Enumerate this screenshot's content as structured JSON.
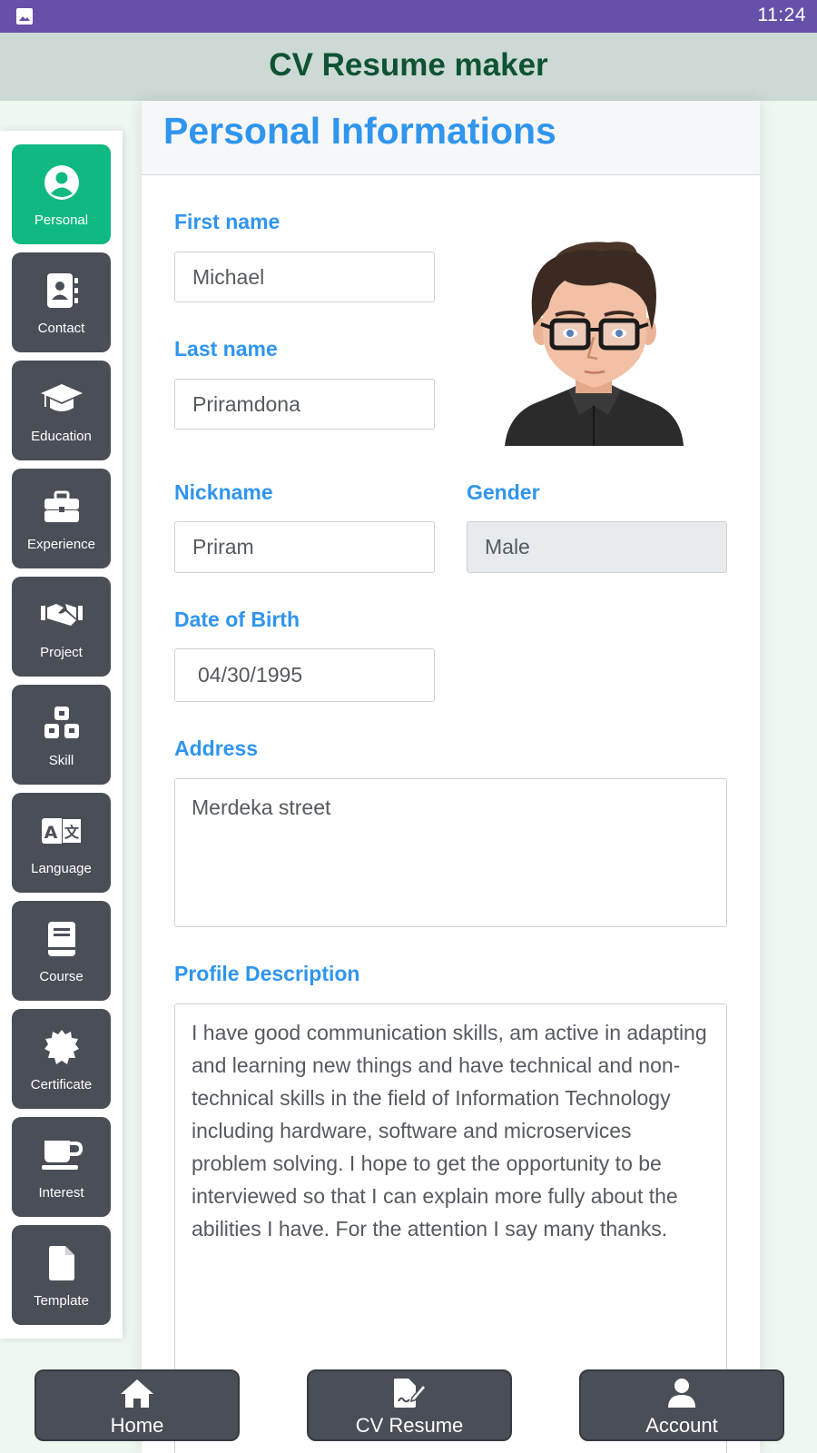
{
  "status_bar": {
    "time": "11:24",
    "image_icon": "image-icon"
  },
  "app_bar": {
    "title": "CV Resume maker"
  },
  "sidebar": {
    "items": [
      {
        "label": "Personal",
        "icon": "user-circle-icon",
        "active": true
      },
      {
        "label": "Contact",
        "icon": "address-book-icon"
      },
      {
        "label": "Education",
        "icon": "graduation-cap-icon"
      },
      {
        "label": "Experience",
        "icon": "briefcase-icon"
      },
      {
        "label": "Project",
        "icon": "handshake-icon"
      },
      {
        "label": "Skill",
        "icon": "cubes-icon"
      },
      {
        "label": "Language",
        "icon": "language-icon"
      },
      {
        "label": "Course",
        "icon": "book-icon"
      },
      {
        "label": "Certificate",
        "icon": "certificate-icon"
      },
      {
        "label": "Interest",
        "icon": "coffee-cup-icon"
      },
      {
        "label": "Template",
        "icon": "file-icon"
      }
    ]
  },
  "form": {
    "heading": "Personal Informations",
    "first_name": {
      "label": "First name",
      "value": "Michael"
    },
    "last_name": {
      "label": "Last name",
      "value": "Priramdona"
    },
    "nickname": {
      "label": "Nickname",
      "value": "Priram"
    },
    "gender": {
      "label": "Gender",
      "value": "Male"
    },
    "dob": {
      "label": "Date of Birth",
      "value": "04/30/1995"
    },
    "address": {
      "label": "Address",
      "value": "Merdeka street"
    },
    "profile": {
      "label": "Profile Description",
      "value": "I have good communication skills, am active in adapting and learning new things and have technical and non-technical skills in the field of Information Technology including hardware, software and microservices problem solving. I hope to get the opportunity to be interviewed so that I can explain more fully about the abilities I have. For the attention I say many thanks."
    }
  },
  "bottom_nav": {
    "items": [
      {
        "label": "Home",
        "icon": "home-icon"
      },
      {
        "label": "CV Resume",
        "icon": "file-signature-icon"
      },
      {
        "label": "Account",
        "icon": "user-icon"
      }
    ]
  },
  "colors": {
    "status_bar": "#6751a8",
    "app_bar": "#ccd9d4",
    "title": "#0f5332",
    "accent_blue": "#2f95ee",
    "active_green": "#10b982",
    "button_dark": "#4a4e57"
  }
}
